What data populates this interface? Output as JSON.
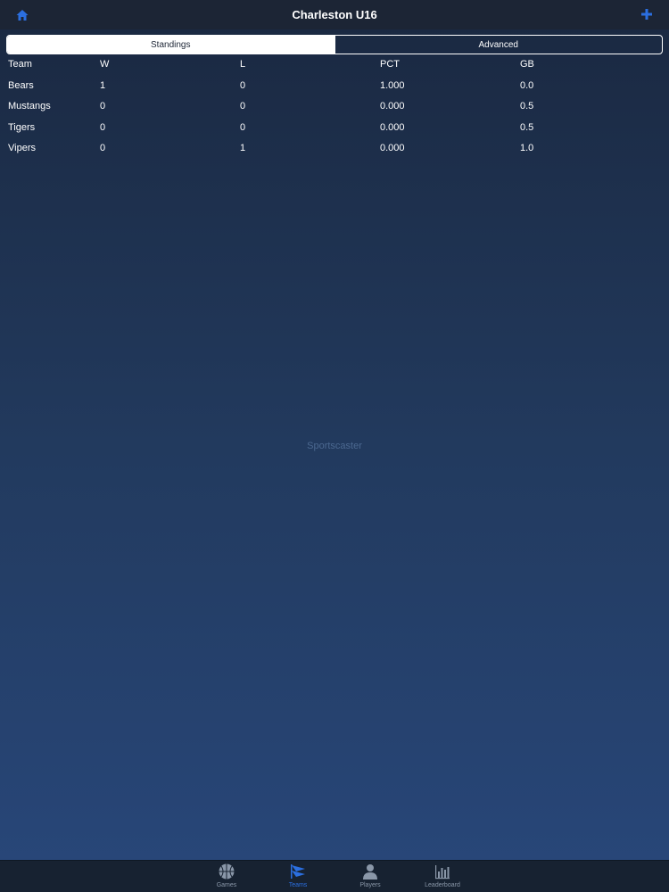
{
  "header": {
    "title": "Charleston U16",
    "home_icon": "home-icon",
    "add_icon": "plus-icon",
    "accent_color": "#2b6fe0"
  },
  "segments": {
    "standings": "Standings",
    "advanced": "Advanced",
    "selected": "Standings"
  },
  "table": {
    "headers": {
      "team": "Team",
      "w": "W",
      "l": "L",
      "pct": "PCT",
      "gb": "GB"
    },
    "rows": [
      {
        "team": "Bears",
        "w": "1",
        "l": "0",
        "pct": "1.000",
        "gb": "0.0"
      },
      {
        "team": "Mustangs",
        "w": "0",
        "l": "0",
        "pct": "0.000",
        "gb": "0.5"
      },
      {
        "team": "Tigers",
        "w": "0",
        "l": "0",
        "pct": "0.000",
        "gb": "0.5"
      },
      {
        "team": "Vipers",
        "w": "0",
        "l": "1",
        "pct": "0.000",
        "gb": "1.0"
      }
    ]
  },
  "watermark": "Sportscaster",
  "tabbar": {
    "items": [
      {
        "label": "Games",
        "icon": "basketball-icon"
      },
      {
        "label": "Teams",
        "icon": "pennant-icon"
      },
      {
        "label": "Players",
        "icon": "player-icon"
      },
      {
        "label": "Leaderboard",
        "icon": "bar-chart-icon"
      }
    ],
    "active": "Teams"
  }
}
